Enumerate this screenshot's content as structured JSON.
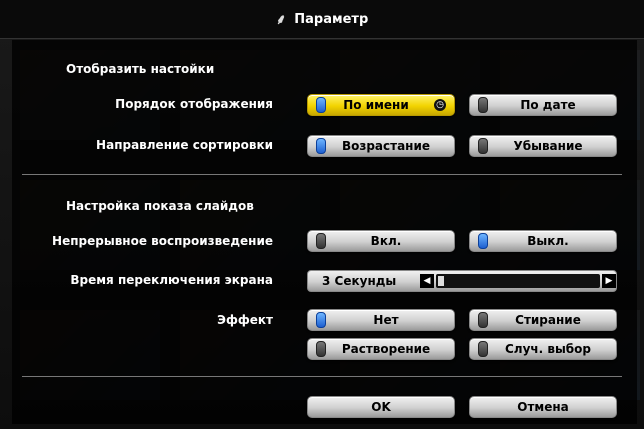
{
  "title": "Параметр",
  "display_settings": {
    "heading": "Отобразить настойки",
    "order_label": "Порядок отображения",
    "order_options": [
      "По имени",
      "По дате"
    ],
    "order_selected": 0,
    "sort_label": "Направление сортировки",
    "sort_options": [
      "Возрастание",
      "Убывание"
    ],
    "sort_selected": 0
  },
  "slideshow": {
    "heading": "Настройка показа слайдов",
    "continuous_label": "Непрерывное воспроизведение",
    "continuous_options": [
      "Вкл.",
      "Выкл."
    ],
    "continuous_selected": 1,
    "interval_label": "Время переключения экрана",
    "interval_value": "3 Секунды",
    "interval_level": 0.0,
    "effect_label": "Эффект",
    "effect_options": [
      "Нет",
      "Стирание",
      "Растворение",
      "Случ. выбор"
    ],
    "effect_selected": 0
  },
  "actions": {
    "ok": "OK",
    "cancel": "Отмена"
  },
  "colors": {
    "selected": "#f2d300",
    "radio_on": "#1d5fd0"
  }
}
